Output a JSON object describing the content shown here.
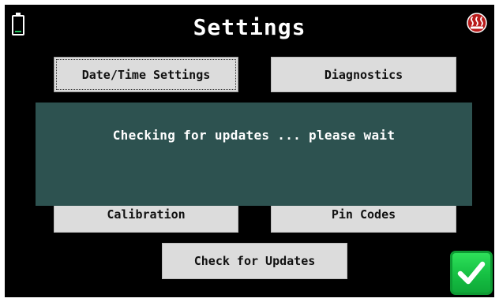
{
  "title": "Settings",
  "buttons": {
    "datetime": "Date/Time Settings",
    "diagnostics": "Diagnostics",
    "calibration": "Calibration",
    "pin_codes": "Pin Codes",
    "check_updates": "Check for Updates"
  },
  "dialog": {
    "message": "Checking for updates ... please wait"
  },
  "status": {
    "battery_level": 0.1
  },
  "icons": {
    "battery": "battery-icon",
    "logo": "heater-logo-icon",
    "confirm": "checkmark-icon"
  },
  "colors": {
    "background": "#000000",
    "button": "#dcdcdc",
    "dialog": "#2d5250",
    "battery_fill": "#22c55e",
    "confirm": "#16c043",
    "logo": "#b91c1c"
  }
}
